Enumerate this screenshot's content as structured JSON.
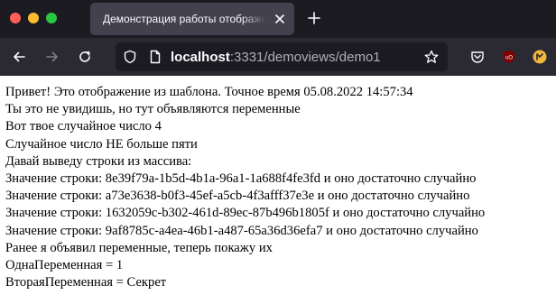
{
  "browser": {
    "tab_title": "Демонстрация работы отображения",
    "url_host": "localhost",
    "url_rest": ":3331/demoviews/demo1"
  },
  "page": {
    "lines": [
      "Привет! Это отображение из шаблона. Точное время 05.08.2022 14:57:34",
      "Ты это не увидишь, но тут объявляются переменные",
      "Вот твое случайное число 4",
      "Случайное число НЕ больше пяти",
      "Давай выведу строки из массива:",
      "Значение строки: 8e39f79a-1b5d-4b1a-96a1-1a688f4fe3fd и оно достаточно случайно",
      "Значение строки: a73e3638-b0f3-45ef-a5cb-4f3afff37e3e и оно достаточно случайно",
      "Значение строки: 1632059c-b302-461d-89ec-87b496b1805f и оно достаточно случайно",
      "Значение строки: 9af8785c-a4ea-46b1-a487-65a36d36efa7 и оно достаточно случайно",
      "Ранее я объявил переменные, теперь покажу их",
      "ОднаПеременная = 1",
      "ВтораяПеременная = Секрет"
    ]
  },
  "icons": {
    "close": "close-icon",
    "new_tab": "plus-icon",
    "back": "arrow-left-icon",
    "forward": "arrow-right-icon",
    "reload": "reload-icon",
    "shield": "shield-icon",
    "page": "page-icon",
    "bookmark": "star-icon",
    "pocket": "pocket-icon",
    "ublock": "ublock-icon",
    "extension": "extension-icon"
  },
  "colors": {
    "titlebar_bg": "#1c1b22",
    "tab_bg": "#42414d",
    "navbar_bg": "#2b2a33",
    "pocket": "#ef4056",
    "ublock": "#800000",
    "extension": "#f0b73a"
  }
}
